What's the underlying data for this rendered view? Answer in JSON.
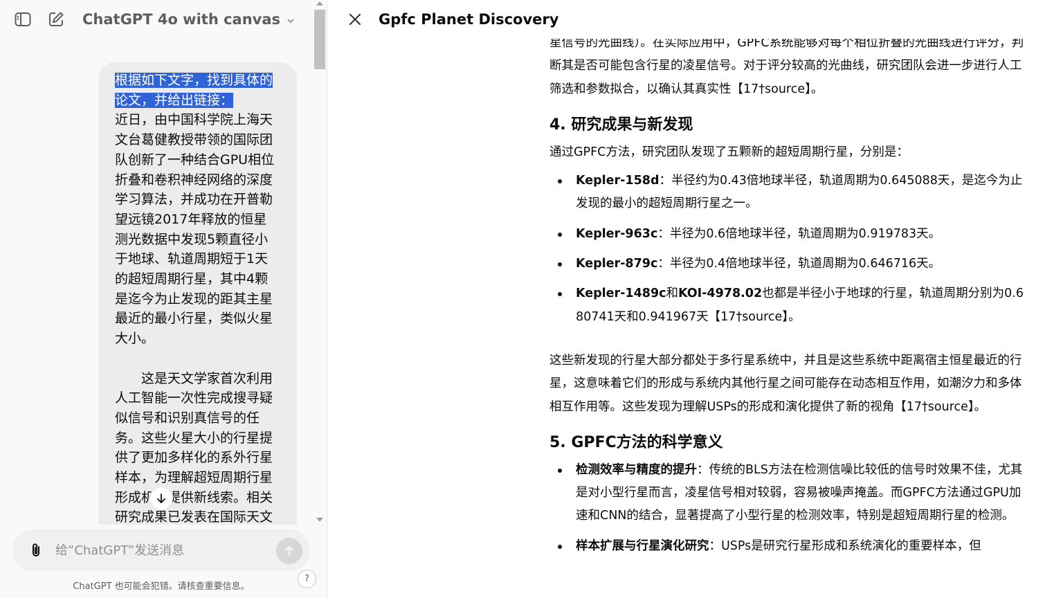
{
  "chat": {
    "model_name": "ChatGPT 4o with canvas",
    "user_message": {
      "highlighted": "根据如下文字，找到具体的论文，并给出链接：",
      "paragraph1": "近日，由中国科学院上海天文台葛健教授带领的国际团队创新了一种结合GPU相位折叠和卷积神经网络的深度学习算法，并成功在开普勒望远镜2017年释放的恒星测光数据中发现5颗直径小于地球、轨道周期短于1天的超短周期行星，其中4颗是迄今为止发现的距其主星最近的最小行星，类似火星大小。",
      "paragraph2": "这是天文学家首次利用人工智能一次性完成搜寻疑似信号和识别真信号的任务。这些火星大小的行星提供了更加多样化的系外行星样本，为理解超短周期行星形成机制提供新线索。相关研究成果已发表在国际天文"
    },
    "composer": {
      "placeholder": "给“ChatGPT”发送消息",
      "value": ""
    },
    "disclaimer": "ChatGPT 也可能会犯错。请核查重要信息。",
    "help_label": "?"
  },
  "canvas": {
    "title": "Gpfc Planet Discovery",
    "top_paragraph": "星信号的光曲线）。在实际应用中，GPFC系统能够对每个相位折叠的光曲线进行评分，判断其是否可能包含行星的凌星信号。对于评分较高的光曲线，研究团队会进一步进行人工筛选和参数拟合，以确认其真实性",
    "cite": "【17†source】",
    "top_paragraph_end": "。",
    "section4": {
      "heading": "4. 研究成果与新发现",
      "intro": "通过GPFC方法，研究团队发现了五颗新的超短周期行星，分别是：",
      "items": [
        {
          "name": "Kepler-158d",
          "text": "：半径约为0.43倍地球半径，轨道周期为0.645088天，是迄今为止发现的最小的超短周期行星之一。"
        },
        {
          "name": "Kepler-963c",
          "text": "：半径为0.6倍地球半径，轨道周期为0.919783天。"
        },
        {
          "name": "Kepler-879c",
          "text": "：半径为0.4倍地球半径，轨道周期为0.646716天。"
        }
      ],
      "last_item": {
        "name_a": "Kepler-1489c",
        "joiner": "和",
        "name_b": "KOI-4978.02",
        "text": "也都是半径小于地球的行星，轨道周期分别为0.680741天和0.941967天",
        "cite": "【17†source】",
        "end": "。"
      },
      "paragraph": "这些新发现的行星大部分都处于多行星系统中，并且是这些系统中距离宿主恒星最近的行星，这意味着它们的形成与系统内其他行星之间可能存在动态相互作用，如潮汐力和多体相互作用等。这些发现为理解USPs的形成和演化提供了新的视角",
      "paragraph_cite": "【17†source】",
      "paragraph_end": "。"
    },
    "section5": {
      "heading": "5. GPFC方法的科学意义",
      "items": [
        {
          "name": "检测效率与精度的提升",
          "text": "：传统的BLS方法在检测信噪比较低的信号时效果不佳，尤其是对小型行星而言，凌星信号相对较弱，容易被噪声掩盖。而GPFC方法通过GPU加速和CNN的结合，显著提高了小型行星的检测效率，特别是超短周期行星的检测。"
        },
        {
          "name": "样本扩展与行星演化研究",
          "text": "：USPs是研究行星形成和系统演化的重要样本，但"
        }
      ]
    }
  }
}
